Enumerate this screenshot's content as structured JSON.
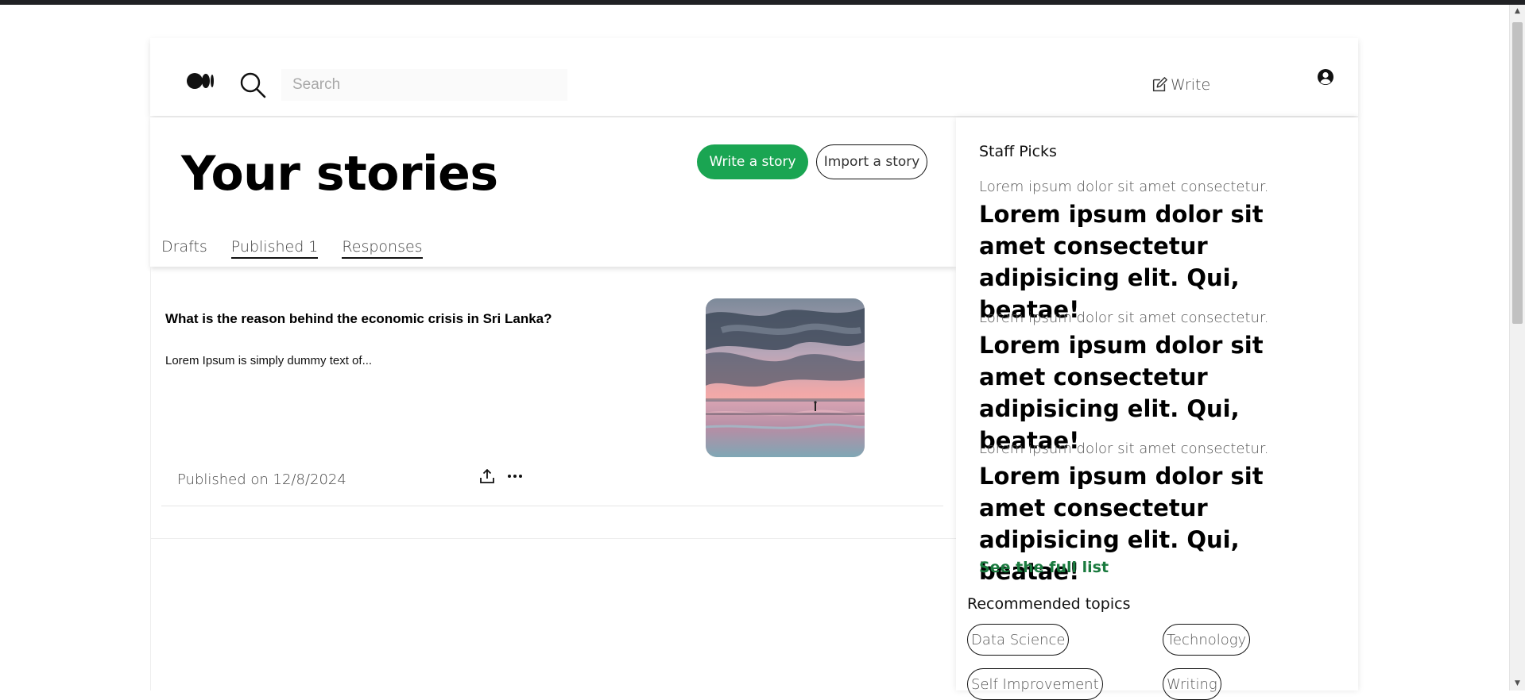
{
  "header": {
    "search_placeholder": "Search",
    "write_label": "Write"
  },
  "main": {
    "title": "Your stories",
    "write_story_label": "Write a story",
    "import_story_label": "Import a story",
    "tabs": [
      {
        "label": "Drafts"
      },
      {
        "label": "Published 1"
      },
      {
        "label": "Responses"
      }
    ],
    "article": {
      "title": "What is the reason behind the economic crisis in Sri Lanka?",
      "excerpt": "Lorem Ipsum is simply dummy text of...",
      "published": "Published on 12/8/2024"
    }
  },
  "sidebar": {
    "staff_picks_title": "Staff Picks",
    "picks": [
      {
        "sub": "Lorem ipsum dolor sit amet consectetur.",
        "title": "Lorem ipsum dolor sit amet consectetur adipisicing elit. Qui, beatae!"
      },
      {
        "sub": "Lorem ipsum dolor sit amet consectetur.",
        "title": "Lorem ipsum dolor sit amet consectetur adipisicing elit. Qui, beatae!"
      },
      {
        "sub": "Lorem ipsum dolor sit amet consectetur.",
        "title": "Lorem ipsum dolor sit amet consectetur adipisicing elit. Qui, beatae!"
      }
    ],
    "see_full_list": "See the full list",
    "recommended_title": "Recommended topics",
    "topics": [
      "Data Science",
      "Technology",
      "Self Improvement",
      "Writing"
    ]
  },
  "colors": {
    "primary_green": "#1aa552",
    "link_green": "#1a7a3e"
  }
}
